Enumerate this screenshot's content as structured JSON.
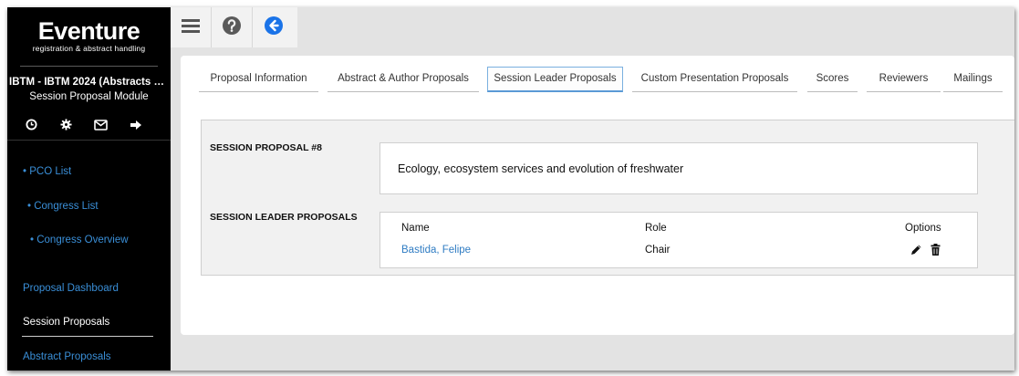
{
  "sidebar": {
    "logo_text": "Eventure",
    "logo_subtitle": "registration & abstract handling",
    "congress_name": "IBTM - IBTM 2024 (Abstracts & Par...",
    "module_name": "Session Proposal Module",
    "icons": [
      "clock-icon",
      "gear-icon",
      "envelope-icon",
      "logout-icon"
    ],
    "nav": {
      "pco_list": "• PCO List",
      "congress_list": "• Congress List",
      "congress_overview": "• Congress Overview",
      "proposal_dashboard": "Proposal Dashboard",
      "session_proposals": "Session Proposals",
      "abstract_proposals": "Abstract Proposals"
    }
  },
  "toolbar": {
    "icons": [
      "menu-icon",
      "help-icon",
      "back-arrow-icon"
    ]
  },
  "tabs": [
    {
      "label": "Proposal Information"
    },
    {
      "label": "Abstract & Author Proposals"
    },
    {
      "label": "Session Leader Proposals",
      "active": true
    },
    {
      "label": "Custom Presentation Proposals"
    },
    {
      "label": "Scores"
    },
    {
      "label": "Reviewers"
    },
    {
      "label": "Mailings"
    }
  ],
  "proposal": {
    "section_label": "SESSION PROPOSAL #8",
    "title": "Ecology, ecosystem services and evolution of freshwater"
  },
  "leaders": {
    "section_label": "SESSION LEADER PROPOSALS",
    "columns": {
      "name": "Name",
      "role": "Role",
      "options": "Options"
    },
    "rows": [
      {
        "name": "Bastida, Felipe",
        "role": "Chair"
      }
    ]
  },
  "colors": {
    "sidebar_bg": "#000000",
    "link_blue": "#2f7cc3",
    "back_button_blue": "#1a73e8",
    "page_bg": "#e3e3e3"
  }
}
